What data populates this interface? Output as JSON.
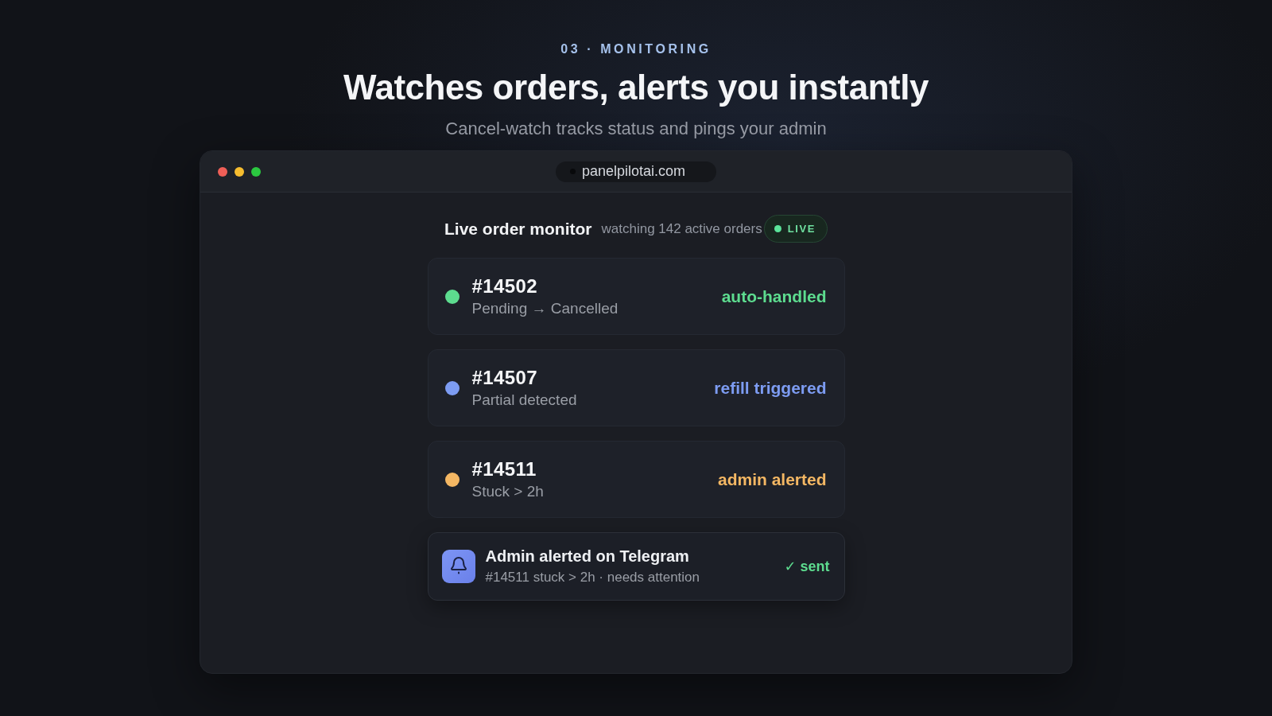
{
  "header": {
    "eyebrow": "03 · MONITORING",
    "title": "Watches orders, alerts you instantly",
    "subtitle": "Cancel-watch tracks status and pings your admin"
  },
  "browser": {
    "url": "panelpilotai.com"
  },
  "monitor": {
    "title": "Live order monitor",
    "subtitle": "watching 142 active orders",
    "badge": "LIVE"
  },
  "orders": [
    {
      "id": "#14502",
      "status": "Pending → Cancelled",
      "action": "auto-handled",
      "color": "#5ddc8f"
    },
    {
      "id": "#14507",
      "status": "Partial detected",
      "action": "refill triggered",
      "color": "#7d9cf2"
    },
    {
      "id": "#14511",
      "status": "Stuck > 2h",
      "action": "admin alerted",
      "color": "#f4b763"
    }
  ],
  "alert": {
    "title": "Admin alerted on Telegram",
    "detail": "#14511 stuck > 2h · needs attention",
    "status": "✓ sent"
  }
}
